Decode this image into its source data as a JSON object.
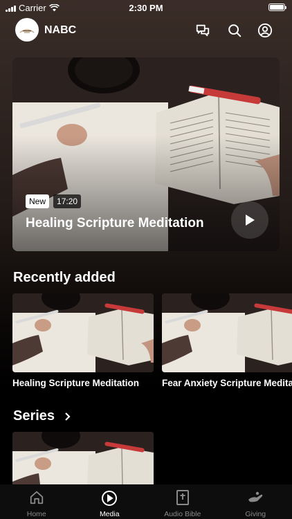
{
  "status_bar": {
    "carrier": "Carrier",
    "time": "2:30 PM"
  },
  "header": {
    "logo_icon": "church-logo-icon",
    "app_name": "NABC",
    "icons": [
      "chat-bubbles-icon",
      "search-icon",
      "account-icon"
    ]
  },
  "hero": {
    "badge": "New",
    "duration": "17:20",
    "title": "Healing Scripture Meditation"
  },
  "recently_added": {
    "title": "Recently added",
    "items": [
      {
        "title": "Healing Scripture Meditation"
      },
      {
        "title": "Fear Anxiety Scripture Meditation"
      }
    ]
  },
  "series": {
    "title": "Series",
    "chevron_icon": "chevron-right-icon"
  },
  "tabs": [
    {
      "label": "Home",
      "icon": "home-icon"
    },
    {
      "label": "Media",
      "icon": "play-circle-icon",
      "active": true
    },
    {
      "label": "Audio Bible",
      "icon": "bible-icon"
    },
    {
      "label": "Giving",
      "icon": "giving-hand-icon"
    }
  ],
  "colors": {
    "pen_red": "#c73a3a",
    "sweater": "#4e3a34",
    "page": "#e9e4dc",
    "background": "#000000"
  }
}
